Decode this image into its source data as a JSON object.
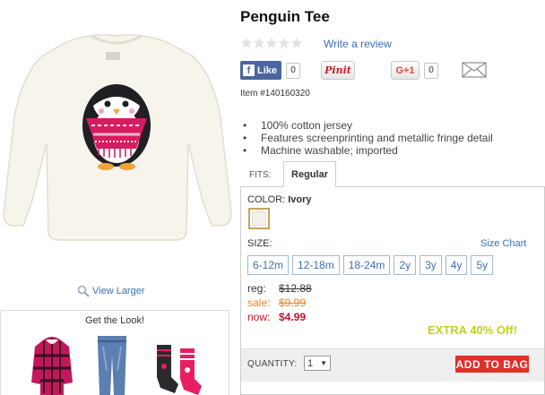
{
  "product": {
    "title": "Penguin Tee",
    "item_number": "Item #140160320",
    "write_review_label": "Write a review",
    "rating": 0,
    "rating_max": 5,
    "features": [
      "100% cotton jersey",
      "Features screenprinting and metallic fringe detail",
      "Machine washable; imported"
    ]
  },
  "social": {
    "facebook_label": "Like",
    "facebook_count": "0",
    "pinterest_label": "Pinit",
    "gplus_label": "G+1",
    "gplus_count": "0"
  },
  "image": {
    "view_larger_label": "View Larger"
  },
  "get_the_look": {
    "title": "Get the Look!"
  },
  "fits": {
    "label": "FITS:",
    "active_tab": "Regular"
  },
  "color": {
    "label": "COLOR:",
    "value": "Ivory"
  },
  "size": {
    "label": "SIZE:",
    "chart_label": "Size Chart",
    "options": [
      "6-12m",
      "12-18m",
      "18-24m",
      "2y",
      "3y",
      "4y",
      "5y"
    ]
  },
  "prices": {
    "reg_label": "reg:",
    "reg_value": "$12.88",
    "sale_label": "sale:",
    "sale_value": "$9.99",
    "now_label": "now:",
    "now_value": "$4.99"
  },
  "promo": {
    "text": "EXTRA 40% Off!"
  },
  "cart": {
    "quantity_label": "QUANTITY:",
    "quantity_value": "1",
    "add_to_bag_label": "ADD TO BAG"
  },
  "colors": {
    "link": "#3b6fb6",
    "sale": "#f08326",
    "now": "#c8102e",
    "promo": "#c4cf1b",
    "add_to_bag": "#e0302a"
  }
}
